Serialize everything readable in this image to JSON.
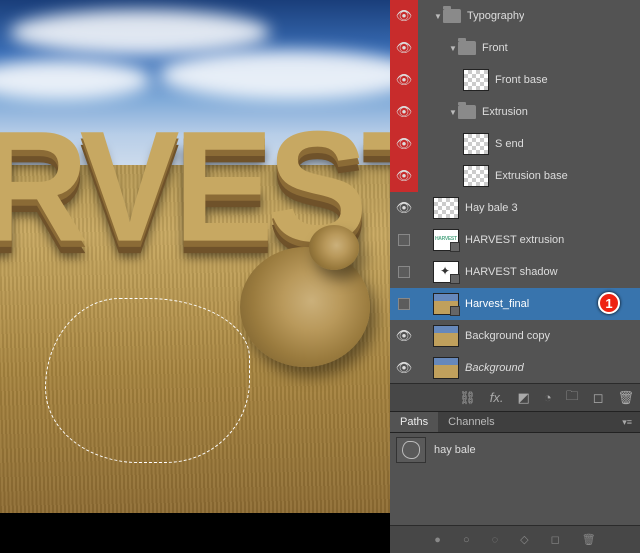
{
  "canvas": {
    "display_text": "RVEST",
    "selection_name": "hay-bale-path-selection"
  },
  "layers": [
    {
      "name": "Typography",
      "type": "group",
      "indent": 1,
      "vis": "eye",
      "red": true,
      "open": true
    },
    {
      "name": "Front",
      "type": "group",
      "indent": 2,
      "vis": "eye",
      "red": true,
      "open": true
    },
    {
      "name": "Front base",
      "type": "layer",
      "indent": 3,
      "vis": "eye",
      "red": true,
      "thumb": "tr"
    },
    {
      "name": "Extrusion",
      "type": "group",
      "indent": 2,
      "vis": "eye",
      "red": true,
      "open": true
    },
    {
      "name": "S end",
      "type": "layer",
      "indent": 3,
      "vis": "eye",
      "red": true,
      "thumb": "tr"
    },
    {
      "name": "Extrusion base",
      "type": "layer",
      "indent": 3,
      "vis": "eye",
      "red": true,
      "thumb": "tr"
    },
    {
      "name": "Hay bale 3",
      "type": "layer",
      "indent": 1,
      "vis": "eye",
      "thumb": "tr"
    },
    {
      "name": "HARVEST extrusion",
      "type": "3d",
      "indent": 1,
      "vis": "off",
      "thumb": "ext"
    },
    {
      "name": "HARVEST shadow",
      "type": "3d",
      "indent": 1,
      "vis": "off",
      "thumb": "shadow3d"
    },
    {
      "name": "Harvest_final",
      "type": "3d",
      "indent": 1,
      "vis": "off",
      "thumb": "pic",
      "selected": true,
      "callout": "1"
    },
    {
      "name": "Background copy",
      "type": "layer",
      "indent": 1,
      "vis": "eye",
      "thumb": "pic"
    },
    {
      "name": "Background",
      "type": "layer",
      "indent": 1,
      "vis": "eye",
      "thumb": "pic",
      "italic": true
    }
  ],
  "layer_actions": {
    "link": "link-layers",
    "fx": "fx.",
    "mask": "add-mask",
    "adjust": "adjustment",
    "group": "new-group",
    "new": "new-layer",
    "delete": "delete-layer"
  },
  "paths_panel": {
    "tabs": [
      "Paths",
      "Channels"
    ],
    "active_tab": 0,
    "items": [
      {
        "name": "hay bale"
      }
    ],
    "footer_icons": [
      "fill-path",
      "stroke-path",
      "path-to-selection",
      "make-work-path",
      "new-path",
      "delete-path"
    ]
  },
  "colors": {
    "accent": "#3874ad",
    "red": "#c82c2c"
  }
}
